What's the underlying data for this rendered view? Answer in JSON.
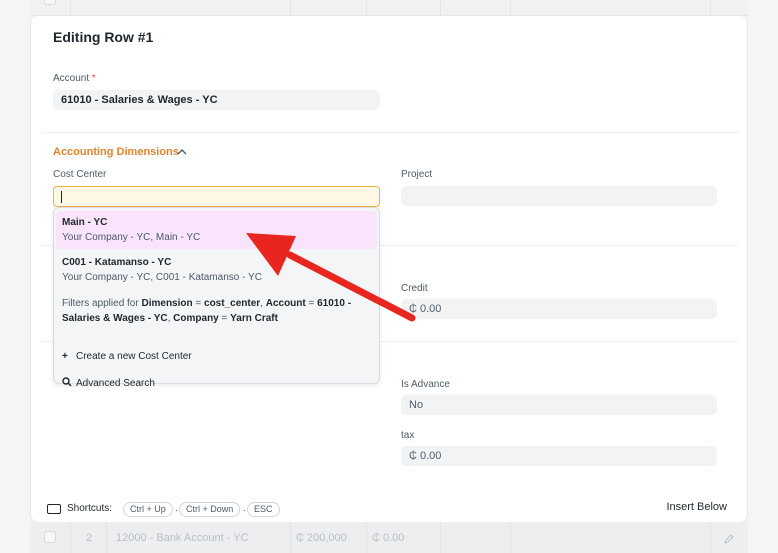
{
  "background_grid": {
    "bottom_row": {
      "index": "2",
      "account": "12000 - Bank Account - YC",
      "debit": "₵ 200,000",
      "credit": "₵ 0.00"
    }
  },
  "modal": {
    "title": "Editing Row #1",
    "account": {
      "label": "Account",
      "required_mark": "*",
      "value": "61010 - Salaries & Wages - YC"
    },
    "section": {
      "label": "Accounting Dimensions",
      "icon": "chevron-up-icon"
    },
    "cost_center": {
      "label": "Cost Center",
      "value": ""
    },
    "project": {
      "label": "Project",
      "value": ""
    },
    "credit": {
      "label": "Credit",
      "value": "₵ 0.00"
    },
    "is_advance": {
      "label": "Is Advance",
      "value": "No"
    },
    "tax": {
      "label": "tax",
      "value": "₵ 0.00"
    }
  },
  "dropdown": {
    "options": [
      {
        "title": "Main - YC",
        "subtitle": "Your Company - YC, Main - YC"
      },
      {
        "title": "C001 - Katamanso - YC",
        "subtitle": "Your Company - YC, C001 - Katamanso - YC"
      }
    ],
    "filters": {
      "prefix": "Filters applied for ",
      "dimension_key": "Dimension",
      "dimension_val": "cost_center",
      "account_key": "Account",
      "account_val": "61010 - Salaries & Wages - YC",
      "company_key": "Company",
      "company_val": "Yarn Craft"
    },
    "create_new": "Create a new Cost Center",
    "advanced_search": "Advanced Search"
  },
  "footer": {
    "shortcuts_label": "Shortcuts:",
    "keys": [
      "Ctrl + Up",
      "Ctrl + Down",
      "ESC"
    ],
    "insert_below": "Insert Below"
  },
  "colors": {
    "accent_orange": "#e0832c",
    "arrow_red": "#e8261f",
    "highlight": "#f9e4fb"
  }
}
